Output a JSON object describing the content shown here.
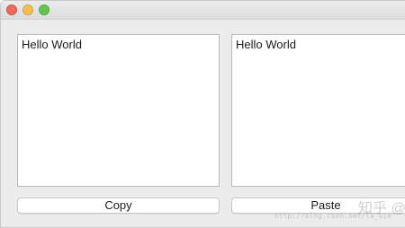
{
  "left_editor": {
    "text": "Hello World"
  },
  "right_editor": {
    "text": "Hello World"
  },
  "buttons": {
    "copy_label": "Copy",
    "paste_label": "Paste"
  },
  "watermark": {
    "text": "知乎 @",
    "url": "http://blog.csdn.net/la_vie"
  },
  "colors": {
    "close": "#ee6a5f",
    "minimize": "#f5be4f",
    "zoom": "#62c655",
    "window_bg": "#ececec"
  }
}
